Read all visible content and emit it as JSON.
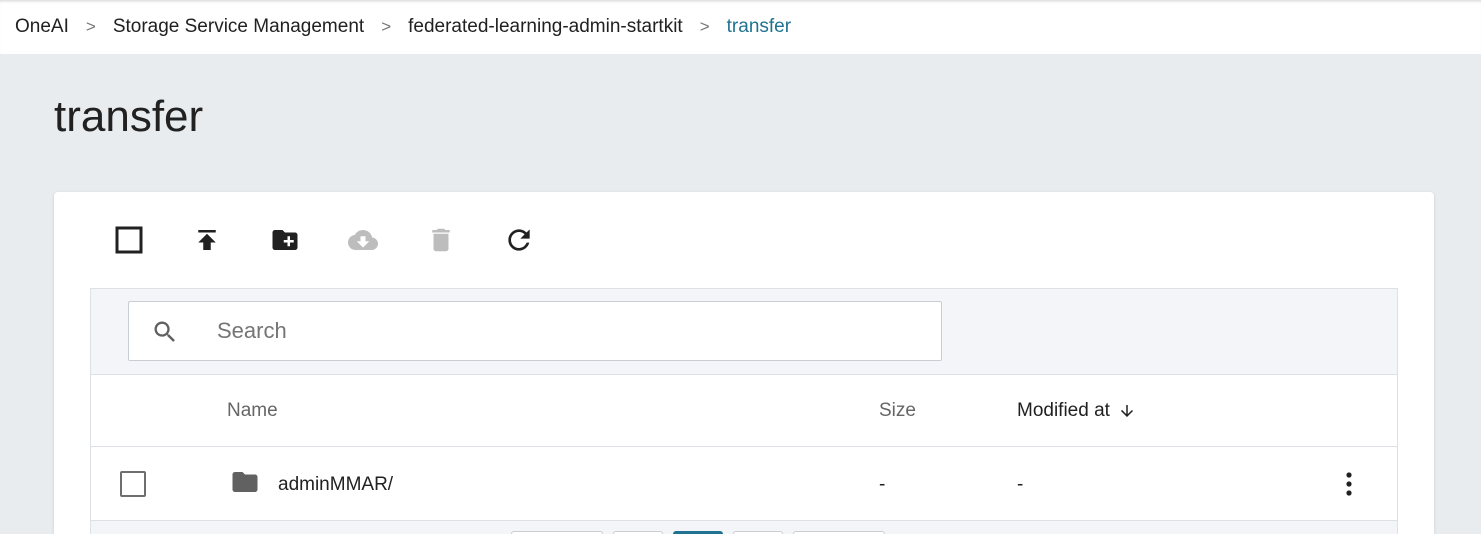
{
  "breadcrumb": {
    "items": [
      {
        "label": "OneAI"
      },
      {
        "label": "Storage Service Management"
      },
      {
        "label": "federated-learning-admin-startkit"
      },
      {
        "label": "transfer"
      }
    ],
    "separator": ">"
  },
  "page": {
    "title": "transfer"
  },
  "toolbar": {
    "buttons": [
      {
        "name": "select-all-checkbox",
        "icon": "checkbox-outline-icon",
        "enabled": true
      },
      {
        "name": "upload-button",
        "icon": "upload-icon",
        "enabled": true
      },
      {
        "name": "new-folder-button",
        "icon": "create-folder-icon",
        "enabled": true
      },
      {
        "name": "download-button",
        "icon": "cloud-download-icon",
        "enabled": false
      },
      {
        "name": "delete-button",
        "icon": "trash-icon",
        "enabled": false
      },
      {
        "name": "refresh-button",
        "icon": "refresh-icon",
        "enabled": true
      }
    ]
  },
  "search": {
    "placeholder": "Search",
    "value": "",
    "icon": "search-icon"
  },
  "table": {
    "columns": [
      {
        "label": "Name"
      },
      {
        "label": "Size"
      },
      {
        "label": "Modified at",
        "sort": "descending",
        "sort_icon": "arrow-down-icon"
      }
    ],
    "rows": [
      {
        "name": "adminMMAR/",
        "size": "-",
        "modified": "-",
        "type": "folder",
        "checked": false
      }
    ]
  },
  "colors": {
    "accent": "#1f7390",
    "disabled_icon": "#bdbdbd",
    "icon": "#212121",
    "page_background": "#e9ecef"
  }
}
